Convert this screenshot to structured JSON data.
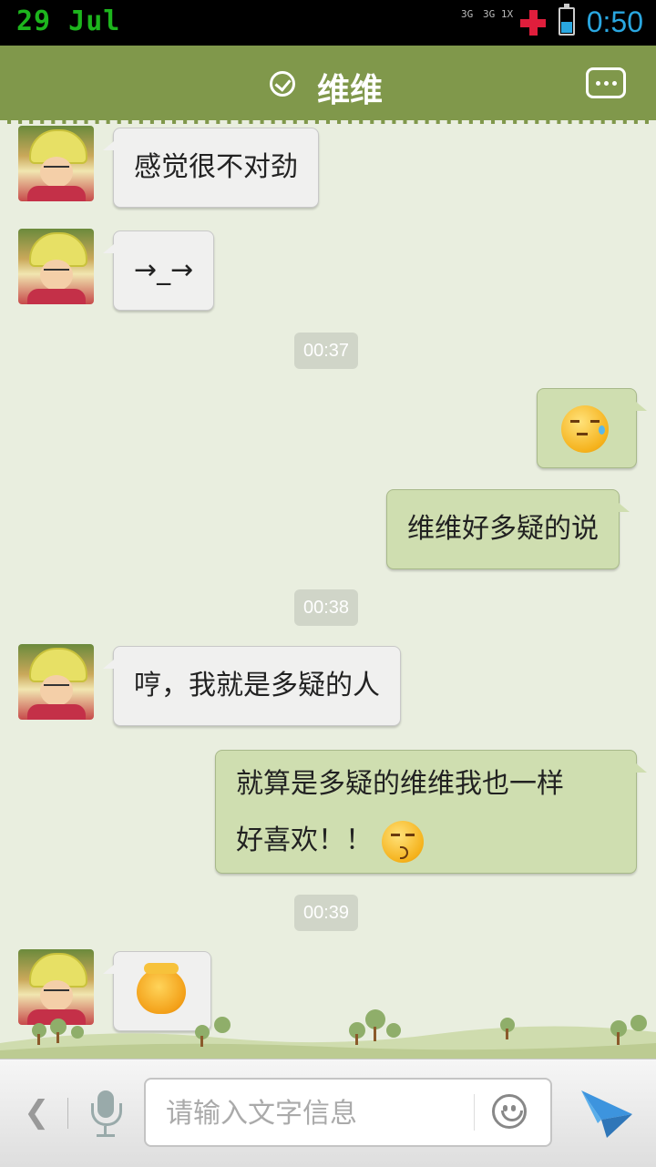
{
  "status_bar": {
    "date": "29 Jul",
    "network_1": "3G",
    "network_2": "3G 1X",
    "time": "0:50",
    "battery_level": 0.45,
    "accent": "#2aa7e0",
    "date_color": "#1db51d"
  },
  "header": {
    "title": "维维",
    "verified_icon": "check-circle-icon",
    "menu_icon": "more-dots-icon",
    "bg": "#80984b"
  },
  "messages": [
    {
      "from": "them",
      "text": "感觉很不对劲"
    },
    {
      "from": "them",
      "text": "→_→"
    },
    {
      "type": "time",
      "text": "00:37"
    },
    {
      "from": "me",
      "emoji": "sweat-smile-emoji"
    },
    {
      "from": "me",
      "text": "维维好多疑的说"
    },
    {
      "type": "time",
      "text": "00:38"
    },
    {
      "from": "them",
      "text": "哼，我就是多疑的人"
    },
    {
      "from": "me",
      "text_line1": "就算是多疑的维维我也一样",
      "text_line2": "好喜欢！！",
      "emoji": "kiss-emoji"
    },
    {
      "type": "time",
      "text": "00:39"
    },
    {
      "from": "them",
      "sticker": "smug-face-sticker"
    }
  ],
  "input": {
    "placeholder": "请输入文字信息",
    "value": "",
    "back_icon": "chevron-left-icon",
    "mic_icon": "microphone-icon",
    "emoji_icon": "smiley-icon",
    "send_icon": "paper-plane-icon",
    "send_color": "#2f86d3"
  }
}
